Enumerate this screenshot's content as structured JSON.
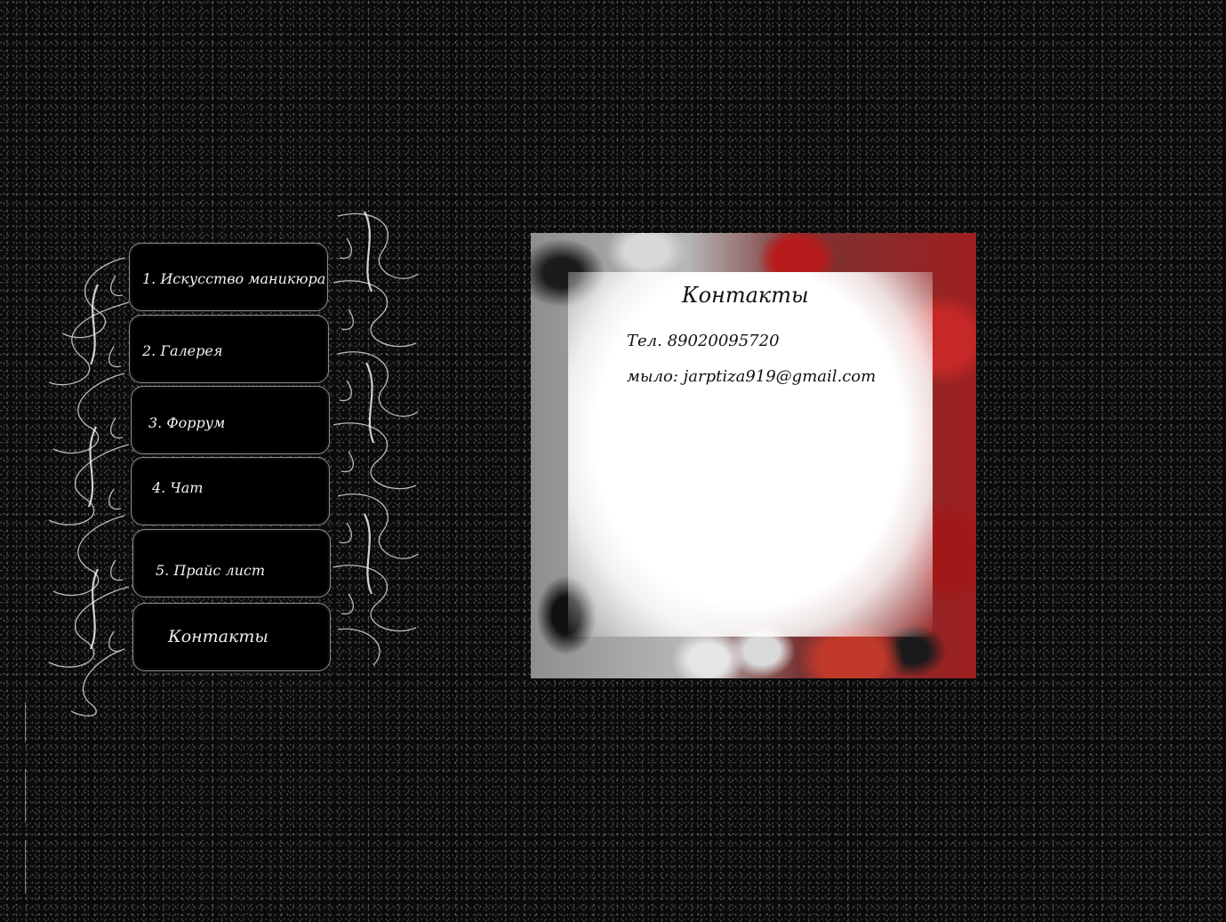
{
  "nav": {
    "items": [
      {
        "label": "1. Искусство маникюра"
      },
      {
        "label": "2. Галерея"
      },
      {
        "label": "3. Форрум"
      },
      {
        "label": "4. Чат"
      },
      {
        "label": "5. Прайс лист"
      },
      {
        "label": "Контакты",
        "active": true
      }
    ]
  },
  "contacts": {
    "title": "Контакты",
    "phone": "Тел. 89020095720",
    "email": "мыло: jarptiza919@gmail.com"
  },
  "colors": {
    "background": "#0b0b0b",
    "nav_item_bg": "#000000",
    "nav_text": "#f2f2f2",
    "panel_text": "#111111",
    "accent_red": "#c62828"
  }
}
